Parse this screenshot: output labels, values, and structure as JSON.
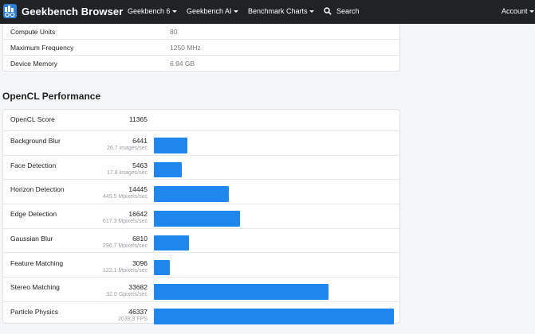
{
  "navbar": {
    "brand": "Geekbench Browser",
    "items": [
      {
        "label": "Geekbench 6"
      },
      {
        "label": "Geekbench AI"
      },
      {
        "label": "Benchmark Charts"
      }
    ],
    "search_label": "Search",
    "account_label": "Account"
  },
  "system_info": [
    {
      "key": "Compute Units",
      "value": "80"
    },
    {
      "key": "Maximum Frequency",
      "value": "1250 MHz"
    },
    {
      "key": "Device Memory",
      "value": "6.94 GB"
    }
  ],
  "opencl": {
    "title": "OpenCL Performance",
    "score_label": "OpenCL Score",
    "score_value": "11365",
    "max_score": 46337,
    "benchmarks": [
      {
        "name": "Background Blur",
        "score": "6441",
        "detail": "26.7 images/sec"
      },
      {
        "name": "Face Detection",
        "score": "5463",
        "detail": "17.8 images/sec"
      },
      {
        "name": "Horizon Detection",
        "score": "14445",
        "detail": "449.5 Mpixels/sec"
      },
      {
        "name": "Edge Detection",
        "score": "16642",
        "detail": "617.3 Mpixels/sec"
      },
      {
        "name": "Gaussian Blur",
        "score": "6810",
        "detail": "296.7 Mpixels/sec"
      },
      {
        "name": "Feature Matching",
        "score": "3096",
        "detail": "122.1 Mpixels/sec"
      },
      {
        "name": "Stereo Matching",
        "score": "33682",
        "detail": "32.0 Gpixels/sec"
      },
      {
        "name": "Particle Physics",
        "score": "46337",
        "detail": "2039.3 FPS"
      }
    ]
  },
  "colors": {
    "navbar": "#202326",
    "bar": "#1f86ee",
    "logo": "#2f7fd8"
  }
}
